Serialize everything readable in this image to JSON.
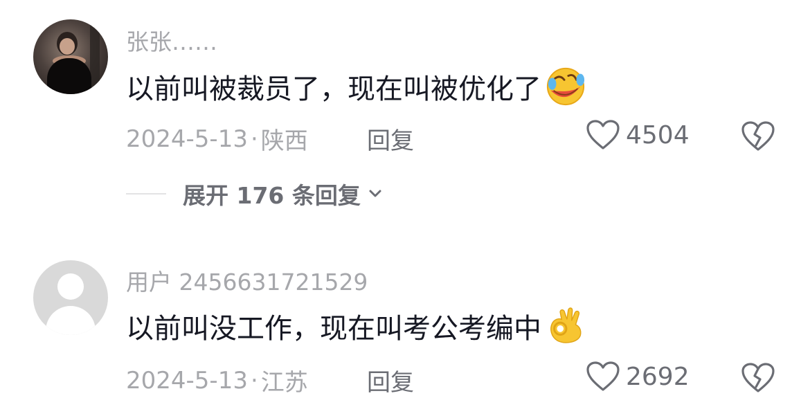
{
  "comments": [
    {
      "username": "张张……",
      "text": "以前叫被裁员了，现在叫被优化了",
      "emoji_icon": "rolling-on-floor-laughing-emoji",
      "date": "2024-5-13",
      "separator": "·",
      "location": "陕西",
      "reply_label": "回复",
      "likes": "4504",
      "expand_label": "展开 176 条回复"
    },
    {
      "username": "用户 2456631721529",
      "text": "以前叫没工作，现在叫考公考编中",
      "emoji_icon": "ok-hand-emoji",
      "date": "2024-5-13",
      "separator": "·",
      "location": "江苏",
      "reply_label": "回复",
      "likes": "2692"
    }
  ],
  "colors": {
    "primary_text": "#161823",
    "secondary_text": "#a6a7ab",
    "action_text": "#6b6d74"
  }
}
